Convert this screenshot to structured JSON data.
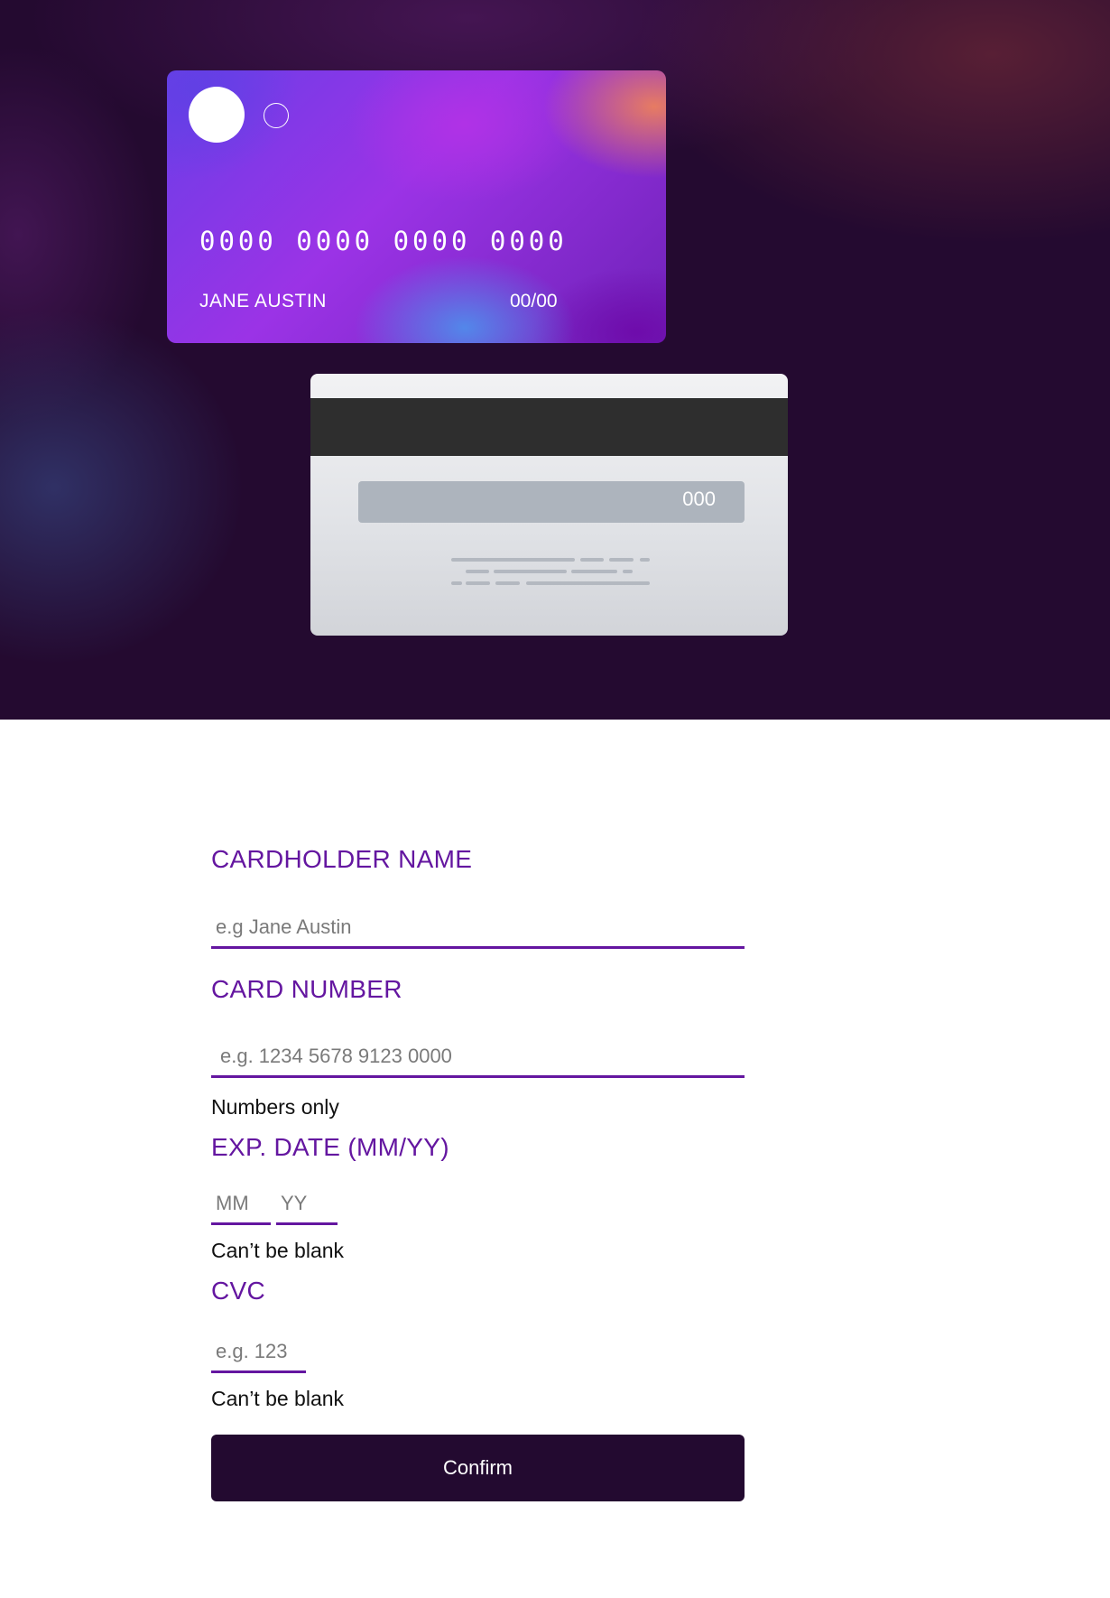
{
  "card_front": {
    "number": "0000 0000 0000 0000",
    "holder_name": "JANE AUSTIN",
    "expiry": "00/00"
  },
  "card_back": {
    "cvc": "000"
  },
  "form": {
    "cardholder": {
      "label": "CARDHOLDER NAME",
      "placeholder": "e.g Jane Austin",
      "value": ""
    },
    "number": {
      "label": "CARD NUMBER",
      "placeholder": "e.g. 1234 5678 9123 0000",
      "value": "",
      "hint": "Numbers only"
    },
    "expiry": {
      "label": "EXP. DATE (MM/YY)",
      "month_placeholder": "MM",
      "year_placeholder": "YY",
      "hint": "Can’t be blank"
    },
    "cvc": {
      "label": "CVC",
      "placeholder": "e.g. 123",
      "value": "",
      "hint": "Can’t be blank"
    },
    "confirm_label": "Confirm"
  },
  "colors": {
    "accent": "#6416a0",
    "dark": "#230a30"
  }
}
